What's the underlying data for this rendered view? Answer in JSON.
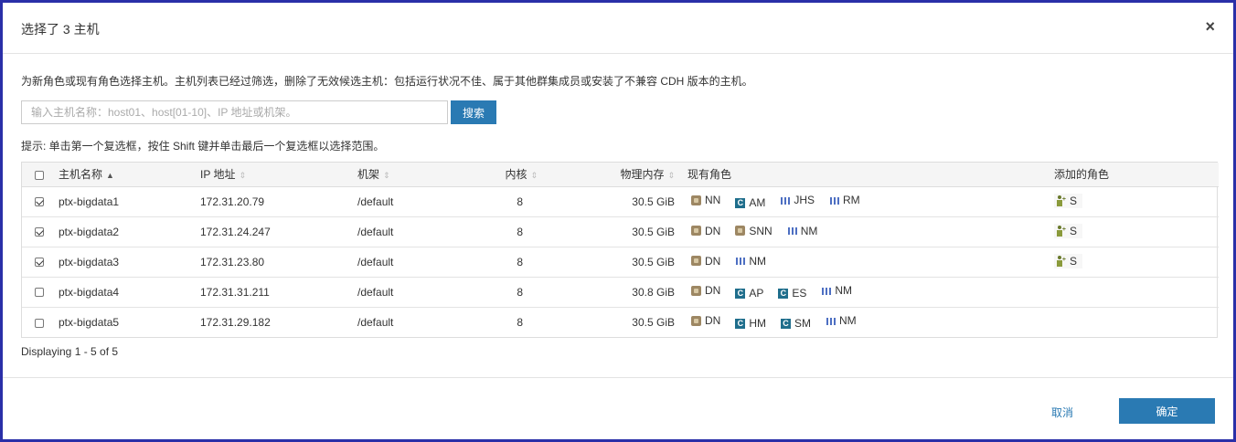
{
  "dialog": {
    "title": "选择了 3 主机",
    "close_symbol": "×",
    "description": "为新角色或现有角色选择主机。主机列表已经过筛选，删除了无效候选主机：包括运行状况不佳、属于其他群集成员或安装了不兼容 CDH 版本的主机。",
    "search": {
      "placeholder": "输入主机名称：host01、host[01-10]、IP 地址或机架。",
      "value": "",
      "button_label": "搜索"
    },
    "hint": "提示: 单击第一个复选框，按住 Shift 键并单击最后一个复选框以选择范围。",
    "columns": {
      "hostname": "主机名称",
      "ip": "IP 地址",
      "rack": "机架",
      "cores": "内核",
      "memory": "物理内存",
      "existing_roles": "现有角色",
      "added_roles": "添加的角色"
    },
    "rows": [
      {
        "checked": true,
        "hostname": "ptx-bigdata1",
        "ip": "172.31.20.79",
        "rack": "/default",
        "cores": "8",
        "memory": "30.5 GiB",
        "roles": [
          {
            "icon": "hdfs-icon",
            "label": "NN"
          },
          {
            "icon": "c-icon",
            "label": "AM"
          },
          {
            "icon": "bars-icon",
            "label": "JHS"
          },
          {
            "icon": "bars-icon",
            "label": "RM"
          }
        ],
        "added": "S"
      },
      {
        "checked": true,
        "hostname": "ptx-bigdata2",
        "ip": "172.31.24.247",
        "rack": "/default",
        "cores": "8",
        "memory": "30.5 GiB",
        "roles": [
          {
            "icon": "hdfs-icon",
            "label": "DN"
          },
          {
            "icon": "hdfs-icon",
            "label": "SNN"
          },
          {
            "icon": "bars-icon",
            "label": "NM"
          }
        ],
        "added": "S"
      },
      {
        "checked": true,
        "hostname": "ptx-bigdata3",
        "ip": "172.31.23.80",
        "rack": "/default",
        "cores": "8",
        "memory": "30.5 GiB",
        "roles": [
          {
            "icon": "hdfs-icon",
            "label": "DN"
          },
          {
            "icon": "bars-icon",
            "label": "NM"
          }
        ],
        "added": "S"
      },
      {
        "checked": false,
        "hostname": "ptx-bigdata4",
        "ip": "172.31.31.211",
        "rack": "/default",
        "cores": "8",
        "memory": "30.8 GiB",
        "roles": [
          {
            "icon": "hdfs-icon",
            "label": "DN"
          },
          {
            "icon": "c-icon",
            "label": "AP"
          },
          {
            "icon": "c-icon",
            "label": "ES"
          },
          {
            "icon": "bars-icon",
            "label": "NM"
          }
        ],
        "added": ""
      },
      {
        "checked": false,
        "hostname": "ptx-bigdata5",
        "ip": "172.31.29.182",
        "rack": "/default",
        "cores": "8",
        "memory": "30.5 GiB",
        "roles": [
          {
            "icon": "hdfs-icon",
            "label": "DN"
          },
          {
            "icon": "c-icon",
            "label": "HM"
          },
          {
            "icon": "c-icon",
            "label": "SM"
          },
          {
            "icon": "bars-icon",
            "label": "NM"
          }
        ],
        "added": ""
      }
    ],
    "paging": "Displaying 1 - 5 of 5",
    "footer": {
      "cancel_label": "取消",
      "ok_label": "确定"
    },
    "colors": {
      "primary": "#2a7ab3",
      "border": "#2a2fa8"
    }
  }
}
